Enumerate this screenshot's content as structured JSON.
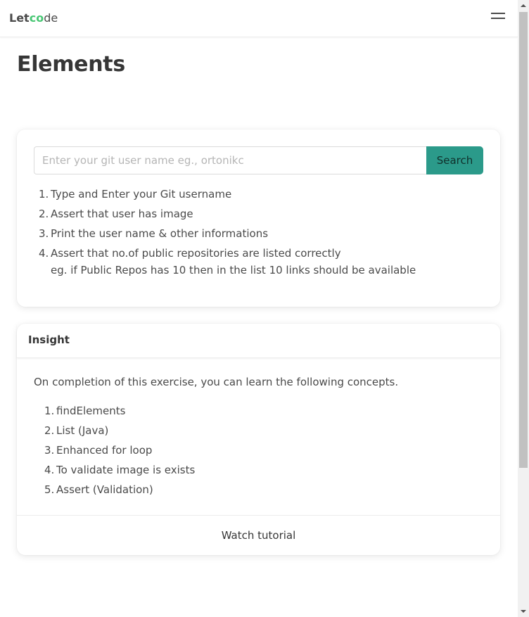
{
  "navbar": {
    "logo_let": "Let",
    "logo_c": "c",
    "logo_o": "o",
    "logo_de": "de",
    "menu_icon": "hamburger-menu-icon"
  },
  "page": {
    "title": "Elements"
  },
  "search": {
    "placeholder": "Enter your git user name eg., ortonikc",
    "value": "",
    "button_label": "Search",
    "button_color": "#2b9a8a"
  },
  "steps": [
    {
      "num": "1.",
      "text": "Type and Enter your Git username"
    },
    {
      "num": "2.",
      "text": "Assert that user has image"
    },
    {
      "num": "3.",
      "text": "Print the user name & other informations"
    },
    {
      "num": "4.",
      "text": "Assert that no.of public repositories are listed correctly",
      "sub": "eg. if Public Repos has 10 then in the list 10 links should be available"
    }
  ],
  "insight": {
    "title": "Insight",
    "intro": "On completion of this exercise, you can learn the following concepts.",
    "concepts": [
      {
        "num": "1.",
        "text": "findElements"
      },
      {
        "num": "2.",
        "text": "List (Java)"
      },
      {
        "num": "3.",
        "text": "Enhanced for loop"
      },
      {
        "num": "4.",
        "text": "To validate image is exists"
      },
      {
        "num": "5.",
        "text": "Assert (Validation)"
      }
    ],
    "footer_link": "Watch tutorial"
  },
  "colors": {
    "accent": "#2b9a8a",
    "logo_accent": "#48c774",
    "text": "#4a4a4a",
    "heading": "#363636"
  }
}
